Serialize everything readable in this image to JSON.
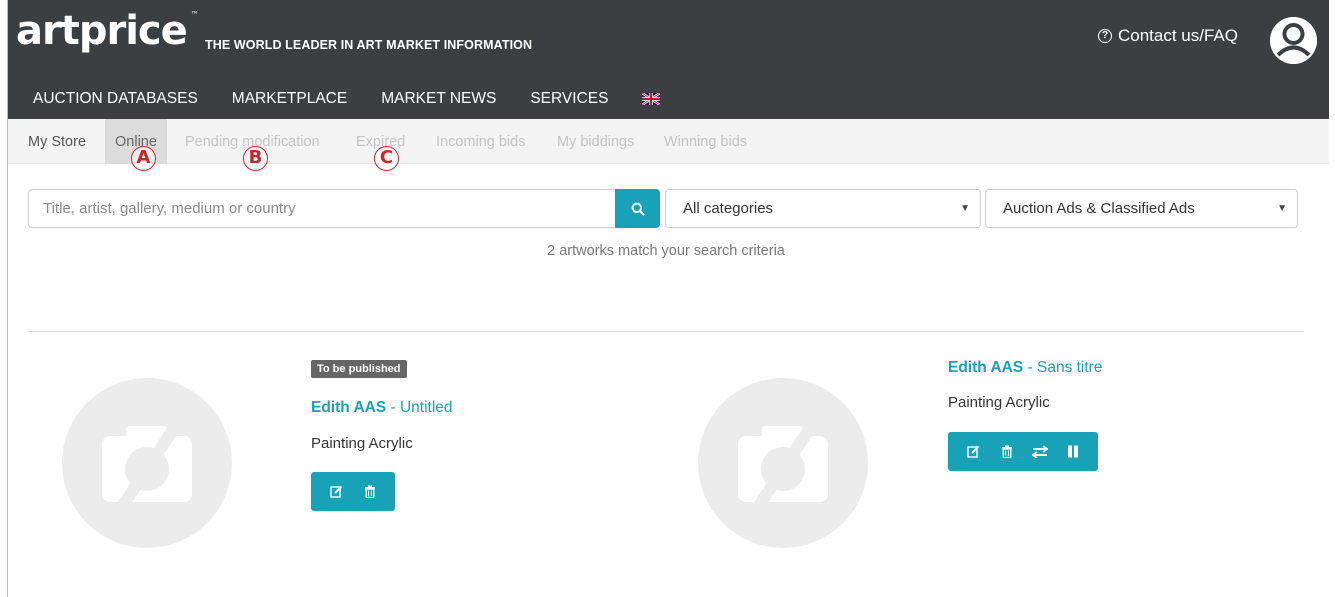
{
  "header": {
    "logo": "artprice",
    "logo_tm": "™",
    "tagline": "THE WORLD LEADER IN ART MARKET INFORMATION",
    "contact_label": "Contact us/FAQ",
    "contact_icon": "question-circle-icon",
    "avatar_icon": "user-circle-icon"
  },
  "nav": {
    "items": [
      "AUCTION DATABASES",
      "MARKETPLACE",
      "MARKET NEWS",
      "SERVICES"
    ],
    "language_icon": "uk-flag-icon"
  },
  "subnav": {
    "tabs": [
      "My Store",
      "Online",
      "Pending modification",
      "Expired",
      "Incoming bids",
      "My biddings",
      "Winning bids"
    ],
    "active_tab": "Online",
    "markers": [
      "A",
      "B",
      "C"
    ]
  },
  "search": {
    "placeholder": "Title, artist, gallery, medium or country",
    "button_icon": "search-icon",
    "category_value": "All categories",
    "type_value": "Auction Ads & Classified Ads",
    "result_text": "2 artworks match your search criteria"
  },
  "artworks": [
    {
      "badge": "To be published",
      "artist": "Edith AAS",
      "separator": " - ",
      "title": "Untitled",
      "medium": "Painting Acrylic",
      "actions": [
        "edit-icon",
        "trash-icon"
      ]
    },
    {
      "badge": "",
      "artist": "Edith AAS",
      "separator": " - ",
      "title": "Sans titre",
      "medium": "Painting Acrylic",
      "actions": [
        "edit-icon",
        "trash-icon",
        "exchange-icon",
        "pause-icon"
      ]
    }
  ],
  "colors": {
    "header_bg": "#3c3f42",
    "accent": "#17a2b8",
    "marker": "#c62828"
  }
}
